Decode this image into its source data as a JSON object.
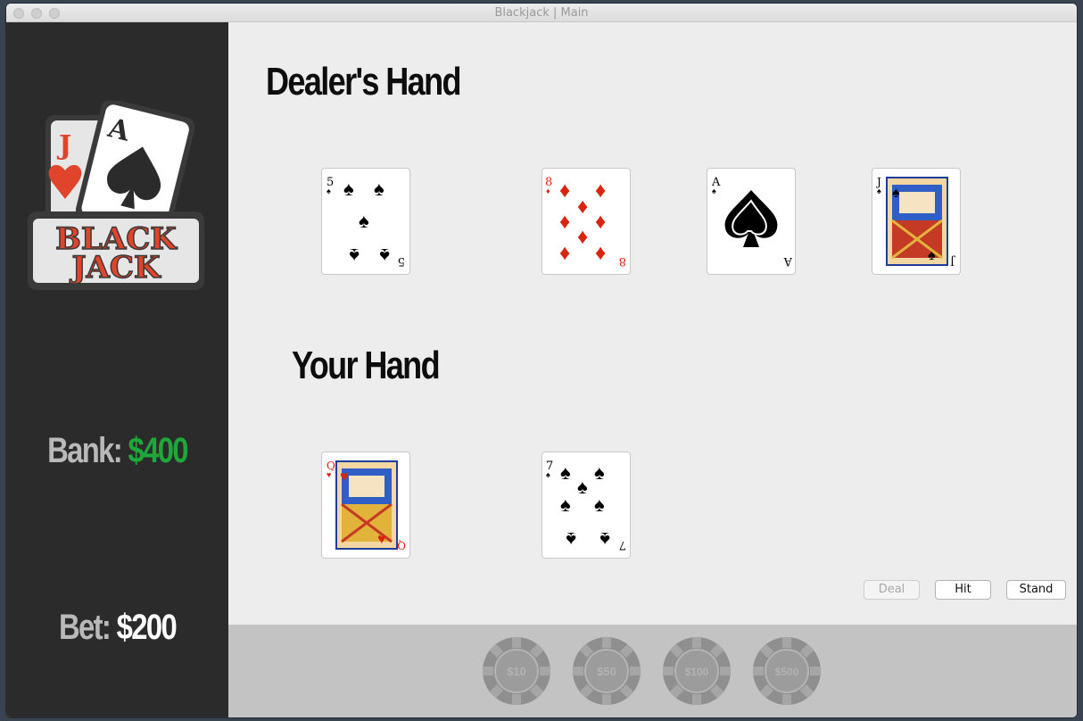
{
  "window": {
    "title": "Blackjack | Main"
  },
  "sidebar": {
    "logo": {
      "line1": "BLACK",
      "line2": "JACK",
      "card_left": "J",
      "card_right": "A"
    },
    "bank": {
      "label": "Bank:",
      "value": "$400"
    },
    "bet": {
      "label": "Bet:",
      "value": "$200"
    }
  },
  "dealer": {
    "heading": "Dealer's Hand",
    "cards": [
      {
        "rank": "5",
        "suit": "spades"
      },
      {
        "rank": "8",
        "suit": "diamonds"
      },
      {
        "rank": "A",
        "suit": "spades"
      },
      {
        "rank": "J",
        "suit": "spades"
      }
    ]
  },
  "player": {
    "heading": "Your Hand",
    "cards": [
      {
        "rank": "Q",
        "suit": "hearts"
      },
      {
        "rank": "7",
        "suit": "spades"
      }
    ]
  },
  "actions": {
    "deal": "Deal",
    "hit": "Hit",
    "stand": "Stand",
    "deal_enabled": false
  },
  "chips": [
    "$10",
    "$50",
    "$100",
    "$500"
  ],
  "colors": {
    "bank": "#1fa83a",
    "red_suit": "#d9240f",
    "black_suit": "#000000",
    "chip": "#8f8f8f"
  }
}
